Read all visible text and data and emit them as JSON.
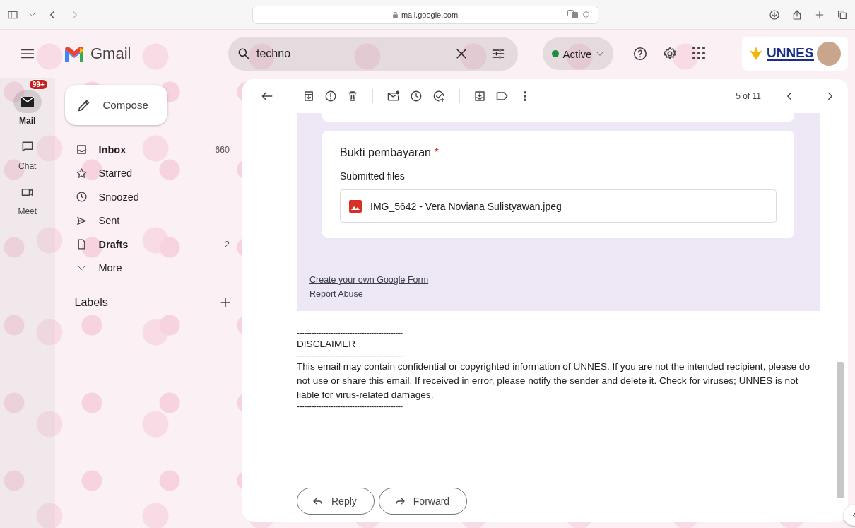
{
  "browser": {
    "url": "mail.google.com"
  },
  "header": {
    "app_name": "Gmail",
    "search": {
      "value": "techno"
    },
    "status": {
      "label": "Active"
    },
    "account": {
      "org": "UNNES"
    }
  },
  "rail": [
    {
      "label": "Mail",
      "selected": true,
      "badge": "99+",
      "kind": "mail"
    },
    {
      "label": "Chat",
      "selected": false,
      "kind": "chat"
    },
    {
      "label": "Meet",
      "selected": false,
      "kind": "meet"
    }
  ],
  "compose": {
    "label": "Compose"
  },
  "folders": [
    {
      "label": "Inbox",
      "count": "660",
      "unread": true,
      "kind": "inbox"
    },
    {
      "label": "Starred",
      "unread": false,
      "kind": "starred"
    },
    {
      "label": "Snoozed",
      "unread": false,
      "kind": "snoozed"
    },
    {
      "label": "Sent",
      "unread": false,
      "kind": "sent"
    },
    {
      "label": "Drafts",
      "count": "2",
      "unread": true,
      "kind": "drafts"
    },
    {
      "label": "More",
      "unread": false,
      "kind": "more"
    }
  ],
  "labels": {
    "title": "Labels"
  },
  "toolbar": {
    "pager": "5 of 11"
  },
  "form": {
    "question": "Bukti pembayaran",
    "required_mark": "*",
    "submitted_label": "Submitted files",
    "files": [
      {
        "name": "IMG_5642 - Vera Noviana Sulistyawan.jpeg"
      }
    ],
    "links": [
      "Create your own Google Form",
      "Report Abuse"
    ]
  },
  "disclaimer": [
    {
      "kind": "rule",
      "text": "--------------------------------------------"
    },
    {
      "kind": "heading",
      "text": "DISCLAIMER"
    },
    {
      "kind": "rule",
      "text": "--------------------------------------------"
    },
    {
      "kind": "body",
      "text": "This email may contain confidential or copyrighted information of UNNES. If you are not the intended recipient, please do not use or share this email. If received in error, please notify the sender and delete it. Check for viruses; UNNES is not liable for virus-related damages."
    },
    {
      "kind": "rule",
      "text": "--------------------------------------------"
    }
  ],
  "actions": [
    {
      "label": "Reply",
      "kind": "reply"
    },
    {
      "label": "Forward",
      "kind": "forward"
    }
  ]
}
